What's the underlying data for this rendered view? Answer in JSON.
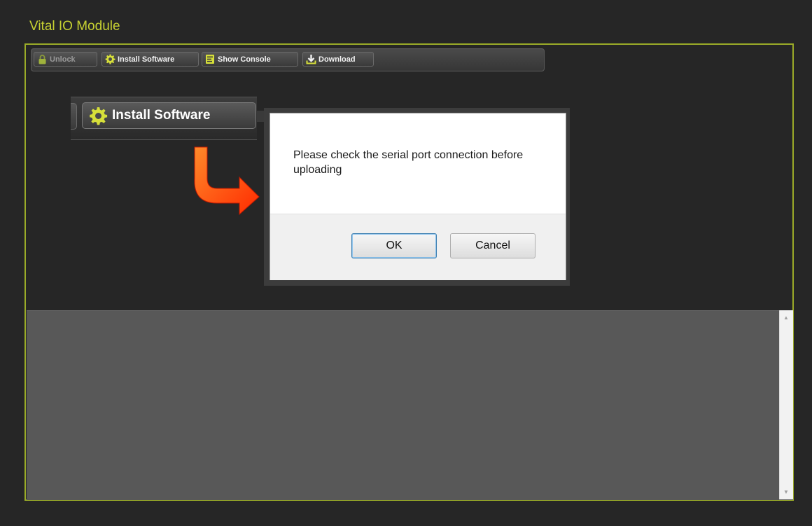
{
  "app": {
    "title": "Vital IO Module"
  },
  "toolbar": {
    "buttons": [
      {
        "label": "Unlock",
        "icon": "lock-icon",
        "enabled": false
      },
      {
        "label": "Install Software",
        "icon": "gear-icon",
        "enabled": true
      },
      {
        "label": "Show Console",
        "icon": "console-icon",
        "enabled": true
      },
      {
        "label": "Download",
        "icon": "download-icon",
        "enabled": true
      }
    ]
  },
  "callout": {
    "label": "Install Software",
    "icon": "gear-icon",
    "arrow_icon": "curved-arrow-icon",
    "arrow_color": "#ff4a00"
  },
  "dialog": {
    "message": "Please check the serial port connection before uploading",
    "ok_label": "OK",
    "cancel_label": "Cancel"
  },
  "colors": {
    "accent": "#c8d232",
    "panel_border": "#9aab28",
    "background": "#262626",
    "console_bg": "#585858"
  }
}
